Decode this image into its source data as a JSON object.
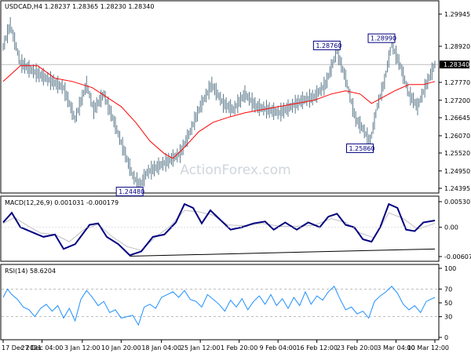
{
  "chart_data": [
    {
      "panel": "price",
      "type": "candlestick",
      "title": "USDCAD,H4  1.28237 1.28365 1.28230 1.28340",
      "last_price_label": "1.28340",
      "last_price": 1.2834,
      "ylim": [
        1.24395,
        1.29945
      ],
      "y_ticks": [
        "1.29945",
        "1.28920",
        "1.27770",
        "1.27200",
        "1.26645",
        "1.26070",
        "1.25520",
        "1.24950",
        "1.24395"
      ],
      "y_tick_values": [
        1.29945,
        1.2892,
        1.2777,
        1.272,
        1.26645,
        1.2607,
        1.2552,
        1.2495,
        1.24395
      ],
      "annotations": [
        {
          "label": "1.28760",
          "x_index": 232,
          "value": 1.2876
        },
        {
          "label": "1.28990",
          "x_index": 270,
          "value": 1.2899
        },
        {
          "label": "1.25860",
          "x_index": 255,
          "value": 1.2586
        },
        {
          "label": "1.24480",
          "x_index": 95,
          "value": 1.2448
        }
      ],
      "price_path": [
        [
          0,
          1.289
        ],
        [
          5,
          1.296
        ],
        [
          12,
          1.284
        ],
        [
          18,
          1.282
        ],
        [
          26,
          1.28
        ],
        [
          34,
          1.278
        ],
        [
          42,
          1.276
        ],
        [
          50,
          1.266
        ],
        [
          58,
          1.277
        ],
        [
          63,
          1.269
        ],
        [
          70,
          1.274
        ],
        [
          78,
          1.264
        ],
        [
          84,
          1.256
        ],
        [
          90,
          1.248
        ],
        [
          95,
          1.2448
        ],
        [
          100,
          1.249
        ],
        [
          108,
          1.251
        ],
        [
          116,
          1.253
        ],
        [
          123,
          1.255
        ],
        [
          130,
          1.262
        ],
        [
          137,
          1.27
        ],
        [
          145,
          1.277
        ],
        [
          153,
          1.271
        ],
        [
          160,
          1.269
        ],
        [
          168,
          1.274
        ],
        [
          176,
          1.27
        ],
        [
          184,
          1.269
        ],
        [
          192,
          1.268
        ],
        [
          200,
          1.27
        ],
        [
          208,
          1.272
        ],
        [
          216,
          1.273
        ],
        [
          224,
          1.277
        ],
        [
          232,
          1.2876
        ],
        [
          238,
          1.279
        ],
        [
          245,
          1.266
        ],
        [
          250,
          1.263
        ],
        [
          255,
          1.2586
        ],
        [
          260,
          1.27
        ],
        [
          265,
          1.278
        ],
        [
          270,
          1.2899
        ],
        [
          276,
          1.283
        ],
        [
          282,
          1.274
        ],
        [
          288,
          1.27
        ],
        [
          294,
          1.277
        ],
        [
          300,
          1.2834
        ]
      ],
      "sma_path": [
        [
          0,
          1.278
        ],
        [
          12,
          1.283
        ],
        [
          24,
          1.283
        ],
        [
          36,
          1.279
        ],
        [
          48,
          1.278
        ],
        [
          62,
          1.276
        ],
        [
          72,
          1.273
        ],
        [
          82,
          1.27
        ],
        [
          92,
          1.265
        ],
        [
          102,
          1.259
        ],
        [
          112,
          1.255
        ],
        [
          118,
          1.2535
        ],
        [
          126,
          1.257
        ],
        [
          136,
          1.262
        ],
        [
          146,
          1.265
        ],
        [
          156,
          1.2665
        ],
        [
          168,
          1.268
        ],
        [
          180,
          1.269
        ],
        [
          192,
          1.27
        ],
        [
          204,
          1.271
        ],
        [
          216,
          1.272
        ],
        [
          228,
          1.274
        ],
        [
          238,
          1.275
        ],
        [
          248,
          1.274
        ],
        [
          256,
          1.271
        ],
        [
          264,
          1.273
        ],
        [
          272,
          1.275
        ],
        [
          282,
          1.277
        ],
        [
          292,
          1.277
        ],
        [
          300,
          1.278
        ]
      ],
      "x_labels": [
        "17 Dec 2021",
        "27 Dec 04:00",
        "3 Jan 12:00",
        "10 Jan 20:00",
        "18 Jan 04:00",
        "25 Jan 12:00",
        "1 Feb 20:00",
        "9 Feb 04:00",
        "16 Feb 12:00",
        "23 Feb 20:00",
        "3 Mar 04:00",
        "10 Mar 12:00"
      ],
      "x_label_index": [
        0,
        27,
        55,
        82,
        110,
        137,
        164,
        191,
        218,
        246,
        273,
        300
      ],
      "watermark": "ActionForex.com",
      "colors": {
        "candles": "#5c7a8c",
        "sma": "#ff0000",
        "annotation_box": "#000080"
      }
    },
    {
      "panel": "macd",
      "type": "line",
      "title": "MACD(12,26,9) 0.001031 -0.000179",
      "ylim": [
        -0.006074,
        0.005307
      ],
      "y_ticks": [
        "0.005307",
        "0.00",
        "-0.006074"
      ],
      "y_tick_values": [
        0.005307,
        0.0,
        -0.006074
      ],
      "series": [
        {
          "name": "MACD",
          "color": "#000080",
          "values": [
            [
              0,
              0.001
            ],
            [
              6,
              0.003
            ],
            [
              12,
              0.0
            ],
            [
              20,
              -0.001
            ],
            [
              28,
              -0.002
            ],
            [
              36,
              -0.0015
            ],
            [
              42,
              -0.0045
            ],
            [
              50,
              -0.0035
            ],
            [
              60,
              0.0005
            ],
            [
              66,
              0.0008
            ],
            [
              72,
              -0.002
            ],
            [
              80,
              -0.0035
            ],
            [
              88,
              -0.0058
            ],
            [
              96,
              -0.005
            ],
            [
              104,
              -0.002
            ],
            [
              112,
              -0.0015
            ],
            [
              120,
              0.001
            ],
            [
              126,
              0.0048
            ],
            [
              132,
              0.004
            ],
            [
              138,
              0.0008
            ],
            [
              144,
              0.0035
            ],
            [
              150,
              0.0018
            ],
            [
              158,
              -0.0005
            ],
            [
              166,
              0.0
            ],
            [
              174,
              0.0008
            ],
            [
              182,
              0.0012
            ],
            [
              188,
              -0.0005
            ],
            [
              196,
              0.001
            ],
            [
              204,
              -0.0005
            ],
            [
              212,
              0.001
            ],
            [
              220,
              0.0
            ],
            [
              226,
              0.0022
            ],
            [
              232,
              0.0028
            ],
            [
              238,
              0.0005
            ],
            [
              244,
              0.0
            ],
            [
              250,
              -0.0025
            ],
            [
              256,
              -0.003
            ],
            [
              262,
              0.0
            ],
            [
              268,
              0.0048
            ],
            [
              274,
              0.004
            ],
            [
              280,
              -0.0005
            ],
            [
              286,
              -0.0008
            ],
            [
              292,
              0.001
            ],
            [
              300,
              0.0014
            ]
          ]
        },
        {
          "name": "Signal",
          "color": "#bfbfbf",
          "values": [
            [
              0,
              0.0008
            ],
            [
              8,
              0.002
            ],
            [
              16,
              0.0005
            ],
            [
              26,
              -0.0012
            ],
            [
              36,
              -0.0015
            ],
            [
              46,
              -0.003
            ],
            [
              56,
              -0.0005
            ],
            [
              66,
              0.0006
            ],
            [
              76,
              -0.002
            ],
            [
              86,
              -0.004
            ],
            [
              96,
              -0.0048
            ],
            [
              106,
              -0.002
            ],
            [
              116,
              0.0002
            ],
            [
              126,
              0.0035
            ],
            [
              136,
              0.0032
            ],
            [
              146,
              0.0025
            ],
            [
              156,
              0.0005
            ],
            [
              168,
              0.0003
            ],
            [
              180,
              0.0008
            ],
            [
              192,
              0.0002
            ],
            [
              204,
              0.0002
            ],
            [
              216,
              0.0004
            ],
            [
              228,
              0.0018
            ],
            [
              238,
              0.001
            ],
            [
              248,
              -0.0012
            ],
            [
              258,
              -0.0022
            ],
            [
              268,
              0.003
            ],
            [
              278,
              0.0018
            ],
            [
              288,
              -0.0004
            ],
            [
              300,
              0.0008
            ]
          ]
        }
      ],
      "trendline": [
        [
          88,
          -0.006
        ],
        [
          300,
          -0.0045
        ]
      ],
      "colors": {
        "trendline": "#000000"
      }
    },
    {
      "panel": "rsi",
      "type": "line",
      "title": "RSI(14) 58.6204",
      "ylim": [
        0,
        100
      ],
      "y_ticks": [
        "100",
        "70",
        "50",
        "30",
        "0"
      ],
      "y_tick_values": [
        100,
        70,
        50,
        30,
        0
      ],
      "levels": [
        30,
        70
      ],
      "series": [
        {
          "name": "RSI",
          "color": "#1e90ff",
          "values": [
            [
              0,
              58
            ],
            [
              3,
              70
            ],
            [
              6,
              62
            ],
            [
              10,
              55
            ],
            [
              14,
              44
            ],
            [
              18,
              40
            ],
            [
              22,
              30
            ],
            [
              26,
              42
            ],
            [
              30,
              48
            ],
            [
              34,
              38
            ],
            [
              38,
              46
            ],
            [
              42,
              28
            ],
            [
              46,
              42
            ],
            [
              50,
              24
            ],
            [
              54,
              55
            ],
            [
              58,
              68
            ],
            [
              62,
              58
            ],
            [
              66,
              46
            ],
            [
              70,
              52
            ],
            [
              74,
              36
            ],
            [
              78,
              40
            ],
            [
              82,
              28
            ],
            [
              86,
              30
            ],
            [
              90,
              32
            ],
            [
              94,
              18
            ],
            [
              98,
              44
            ],
            [
              102,
              48
            ],
            [
              106,
              42
            ],
            [
              110,
              58
            ],
            [
              114,
              62
            ],
            [
              118,
              66
            ],
            [
              122,
              58
            ],
            [
              126,
              68
            ],
            [
              130,
              55
            ],
            [
              134,
              52
            ],
            [
              138,
              44
            ],
            [
              142,
              62
            ],
            [
              146,
              55
            ],
            [
              150,
              48
            ],
            [
              154,
              38
            ],
            [
              158,
              54
            ],
            [
              162,
              44
            ],
            [
              166,
              56
            ],
            [
              170,
              40
            ],
            [
              174,
              52
            ],
            [
              178,
              60
            ],
            [
              182,
              48
            ],
            [
              186,
              62
            ],
            [
              190,
              46
            ],
            [
              194,
              56
            ],
            [
              198,
              42
            ],
            [
              202,
              58
            ],
            [
              206,
              46
            ],
            [
              210,
              66
            ],
            [
              214,
              48
            ],
            [
              218,
              60
            ],
            [
              222,
              54
            ],
            [
              226,
              66
            ],
            [
              230,
              74
            ],
            [
              234,
              56
            ],
            [
              238,
              40
            ],
            [
              242,
              44
            ],
            [
              246,
              34
            ],
            [
              250,
              38
            ],
            [
              254,
              28
            ],
            [
              258,
              52
            ],
            [
              262,
              60
            ],
            [
              266,
              66
            ],
            [
              270,
              74
            ],
            [
              274,
              64
            ],
            [
              278,
              48
            ],
            [
              282,
              40
            ],
            [
              286,
              46
            ],
            [
              290,
              36
            ],
            [
              294,
              52
            ],
            [
              298,
              56
            ],
            [
              300,
              58
            ]
          ]
        }
      ],
      "colors": {
        "levels": "#a9a9a9"
      }
    }
  ]
}
